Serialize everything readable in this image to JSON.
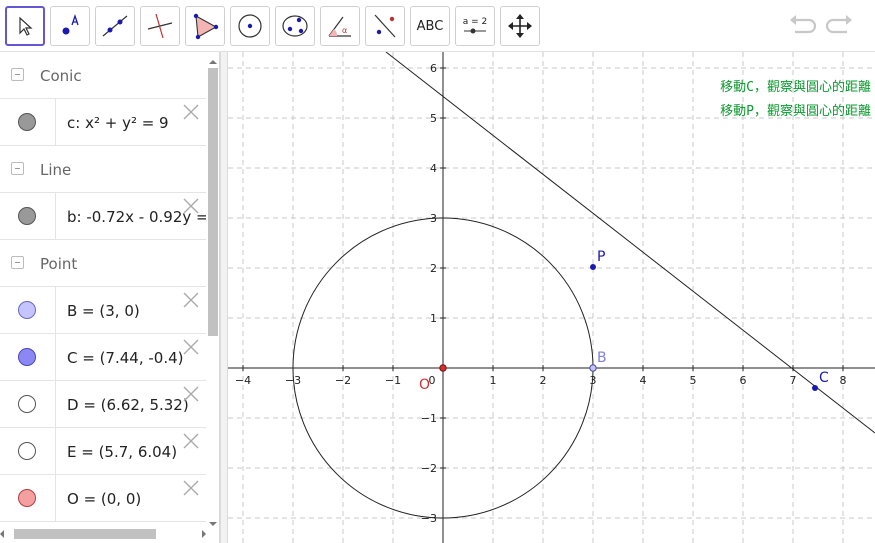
{
  "toolbar": {
    "tools": [
      {
        "name": "move-tool",
        "label": ""
      },
      {
        "name": "point-tool",
        "label": ""
      },
      {
        "name": "line-tool",
        "label": ""
      },
      {
        "name": "perpendicular-line-tool",
        "label": ""
      },
      {
        "name": "polygon-tool",
        "label": ""
      },
      {
        "name": "circle-center-point-tool",
        "label": ""
      },
      {
        "name": "conic-tool",
        "label": ""
      },
      {
        "name": "angle-tool",
        "label": ""
      },
      {
        "name": "reflect-tool",
        "label": ""
      },
      {
        "name": "text-tool",
        "label": "ABC"
      },
      {
        "name": "slider-tool",
        "label": "a = 2"
      },
      {
        "name": "move-graphics-view-tool",
        "label": ""
      }
    ],
    "selected_tool": "move-tool"
  },
  "algebra": {
    "categories": {
      "conic": "Conic",
      "line": "Line",
      "point": "Point"
    },
    "items": {
      "c": {
        "text": "c: x² + y² = 9",
        "color": "#999999"
      },
      "b": {
        "text": "b: -0.72x - 0.92y = ",
        "color": "#999999"
      },
      "B": {
        "text": "B = (3, 0)",
        "color": "#c5c4ff"
      },
      "C": {
        "text": "C = (7.44, -0.4)",
        "color": "#8b88f6"
      },
      "D": {
        "text": "D = (6.62, 5.32)",
        "color": "#ffffff"
      },
      "E": {
        "text": "E = (5.7, 6.04)",
        "color": "#ffffff"
      },
      "O": {
        "text": "O = (0, 0)",
        "color": "#f4a0a0"
      }
    }
  },
  "graphics": {
    "x_ticks": [
      "−4",
      "−3",
      "−2",
      "−1",
      "0",
      "1",
      "2",
      "3",
      "4",
      "5",
      "6",
      "7",
      "8"
    ],
    "y_ticks": [
      "6",
      "5",
      "4",
      "3",
      "2",
      "1",
      "−1",
      "−2",
      "−3"
    ],
    "points": {
      "P": {
        "label": "P",
        "color": "#1a1ab0"
      },
      "B": {
        "label": "B",
        "color": "#8080e0"
      },
      "C": {
        "label": "C",
        "color": "#1a1ab0"
      },
      "O": {
        "label": "O",
        "color": "#d03030"
      }
    },
    "notes": [
      "移動C，觀察與圓心的距離",
      "移動P，觀察與圓心的距離"
    ]
  }
}
